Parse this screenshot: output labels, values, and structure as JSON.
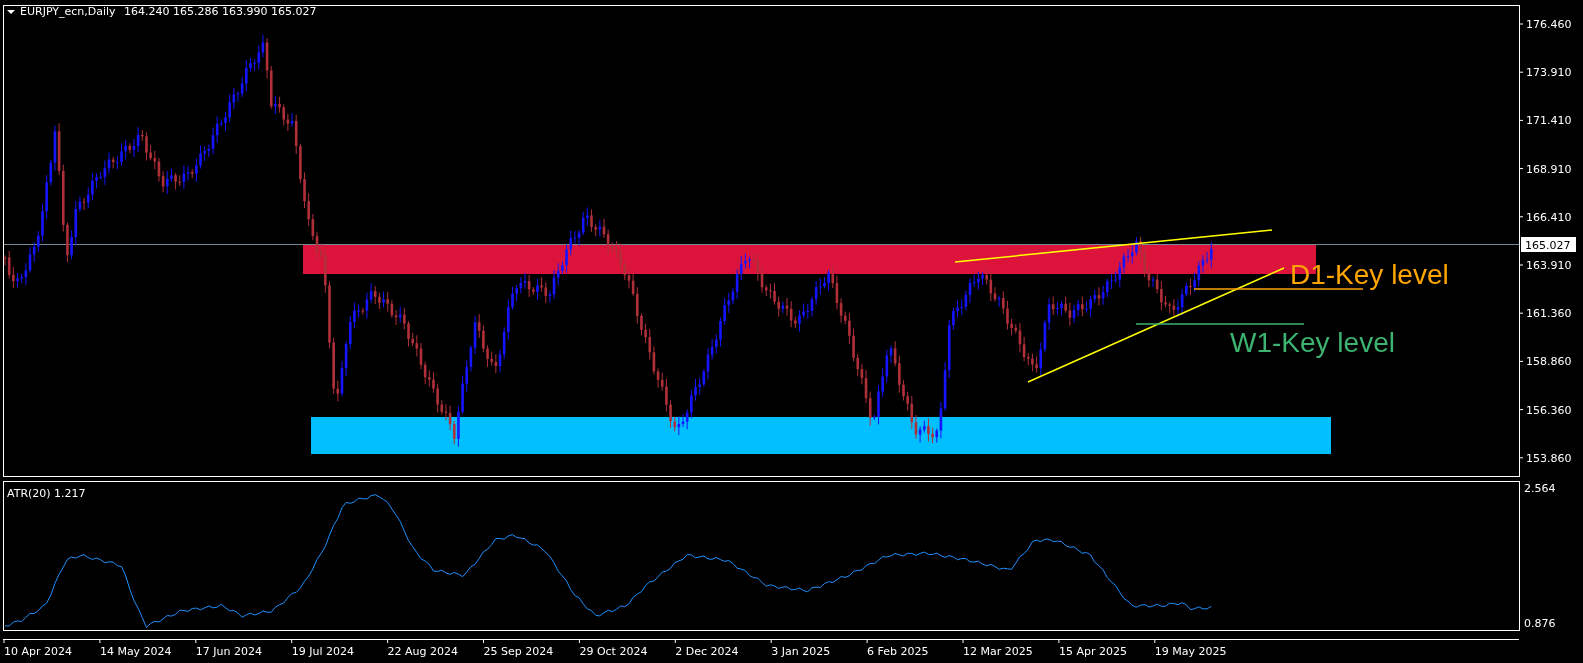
{
  "header": {
    "symbol": "EURJPY_ecn,Daily",
    "ohlc": "164.240 165.286 163.990 165.027"
  },
  "price_axis": {
    "ticks": [
      "176.460",
      "173.910",
      "171.410",
      "168.910",
      "166.410",
      "163.910",
      "161.360",
      "158.860",
      "156.360",
      "153.860"
    ],
    "current_price": "165.027"
  },
  "zones": [
    {
      "kind": "resistance",
      "color": "#dc143c"
    },
    {
      "kind": "support",
      "color": "#00bfff"
    }
  ],
  "key_levels": [
    {
      "label": "D1-Key level",
      "color": "#ffa500"
    },
    {
      "label": "W1-Key level",
      "color": "#3cb371"
    }
  ],
  "indicator": {
    "label": "ATR(20) 1.217",
    "ticks": [
      "2.564",
      "0.876"
    ]
  },
  "time_axis": [
    "10 Apr 2024",
    "14 May 2024",
    "17 Jun 2024",
    "19 Jul 2024",
    "22 Aug 2024",
    "25 Sep 2024",
    "29 Oct 2024",
    "2 Dec 2024",
    "3 Jan 2025",
    "6 Feb 2025",
    "12 Mar 2025",
    "15 Apr 2025",
    "19 May 2025"
  ]
}
